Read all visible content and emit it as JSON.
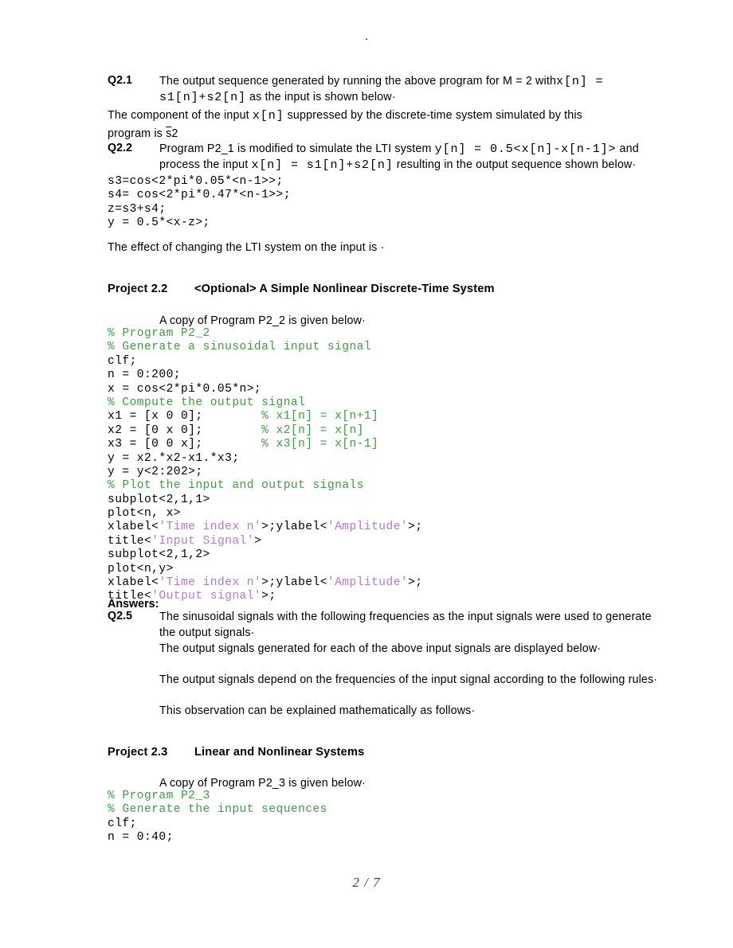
{
  "page": {
    "top_mark": ".",
    "footer": "2 / 7"
  },
  "q21": {
    "label": "Q2.1",
    "text_a": "The  output  sequence  generated  by  running  the  above  program  for  M  =  2  with",
    "math_a": "x[n] =",
    "math_b": "s1[n]+s2[n]",
    "text_b": " as the input is shown below·"
  },
  "component": {
    "text_a": "The component of the input ",
    "math_a": "x[n]",
    "text_b": " suppressed by the discrete-time system simulated by this",
    "line2_a": "program is ",
    "line2_strike": "s",
    "line2_b": "2"
  },
  "q22": {
    "label": "Q2.2",
    "text_a": "Program P2_1 is modified to simulate the LTI system ",
    "math_a": "y[n] = 0.5<x[n]-x[n-1]>",
    "text_b": " and",
    "line2_a": "process the input ",
    "math_b": "x[n] = s1[n]+s2[n]",
    "line2_b": " resulting in the output sequence shown below·"
  },
  "code_a": {
    "lines": [
      [
        {
          "t": "s3=cos<2*pi*0.05*<n-1>>;",
          "c": "plain"
        }
      ],
      [
        {
          "t": "s4= cos<2*pi*0.47*<n-1>>;",
          "c": "plain"
        }
      ],
      [
        {
          "t": "z=s3+s4;",
          "c": "plain"
        }
      ],
      [
        {
          "t": "y = 0.5*<x-z>;",
          "c": "plain"
        }
      ]
    ]
  },
  "effect": {
    "text": "The effect of changing the LTI system on the input is ",
    "mark": "·"
  },
  "project22": {
    "label": "Project 2.2",
    "title": "<Optional> A Simple Nonlinear Discrete-Time System",
    "copy_line": "A copy of Program P2_2 is given below·"
  },
  "code_main": {
    "lines": [
      [
        {
          "t": "% Program P2_2",
          "c": "comment"
        }
      ],
      [
        {
          "t": "% Generate a sinusoidal input signal",
          "c": "comment"
        }
      ],
      [
        {
          "t": "clf;",
          "c": "plain"
        }
      ],
      [
        {
          "t": "n = 0:200;",
          "c": "plain"
        }
      ],
      [
        {
          "t": "x = cos<2*pi*0.05*n>;",
          "c": "plain"
        }
      ],
      [
        {
          "t": "% Compute the output signal",
          "c": "comment"
        }
      ],
      [
        {
          "t": "x1 = [x 0 0];        ",
          "c": "plain"
        },
        {
          "t": "% x1[n] = x[n+1]",
          "c": "comment"
        }
      ],
      [
        {
          "t": "x2 = [0 x 0];        ",
          "c": "plain"
        },
        {
          "t": "% x2[n] = x[n]",
          "c": "comment"
        }
      ],
      [
        {
          "t": "x3 = [0 0 x];        ",
          "c": "plain"
        },
        {
          "t": "% x3[n] = x[n-1]",
          "c": "comment"
        }
      ],
      [
        {
          "t": "y = x2.*x2-x1.*x3;",
          "c": "plain"
        }
      ],
      [
        {
          "t": "y = y<2:202>;",
          "c": "plain"
        }
      ],
      [
        {
          "t": "% Plot the input and output signals",
          "c": "comment"
        }
      ],
      [
        {
          "t": "subplot<2,1,1>",
          "c": "plain"
        }
      ],
      [
        {
          "t": "plot<n, x>",
          "c": "plain"
        }
      ],
      [
        {
          "t": "xlabel<",
          "c": "plain"
        },
        {
          "t": "'Time index n'",
          "c": "string"
        },
        {
          "t": ">;ylabel<",
          "c": "plain"
        },
        {
          "t": "'Amplitude'",
          "c": "string"
        },
        {
          "t": ">;",
          "c": "plain"
        }
      ],
      [
        {
          "t": "title<",
          "c": "plain"
        },
        {
          "t": "'Input Signal'",
          "c": "string"
        },
        {
          "t": ">",
          "c": "plain"
        }
      ],
      [
        {
          "t": "subplot<2,1,2>",
          "c": "plain"
        }
      ],
      [
        {
          "t": "plot<n,y>",
          "c": "plain"
        }
      ],
      [
        {
          "t": "xlabel<",
          "c": "plain"
        },
        {
          "t": "'Time index n'",
          "c": "string"
        },
        {
          "t": ">;ylabel<",
          "c": "plain"
        },
        {
          "t": "'Amplitude'",
          "c": "string"
        },
        {
          "t": ">;",
          "c": "plain"
        }
      ],
      [
        {
          "t": "title<",
          "c": "plain"
        },
        {
          "t": "'Output signal'",
          "c": "string"
        },
        {
          "t": ">;",
          "c": "plain"
        }
      ]
    ]
  },
  "answers": {
    "label": "Answers:",
    "q25_label": "Q2.5",
    "line1": "The sinusoidal signals with the following frequencies as the input signals were used to generate",
    "line2": "the output signals·",
    "line3": "The output signals generated for each of the above input signals are displayed below·",
    "line4": "The output signals depend on the frequencies of the input signal according to the following rules·",
    "line5": "This observation can be explained mathematically as follows·"
  },
  "project23": {
    "label": "Project 2.3",
    "title": "Linear and Nonlinear Systems",
    "copy_line": "A copy of Program P2_3 is given below·"
  },
  "code_b": {
    "lines": [
      [
        {
          "t": "% Program P2_3",
          "c": "comment"
        }
      ],
      [
        {
          "t": "% Generate the input sequences",
          "c": "comment"
        }
      ],
      [
        {
          "t": "clf;",
          "c": "plain"
        }
      ],
      [
        {
          "t": "n = 0:40;",
          "c": "plain"
        }
      ]
    ]
  },
  "colors": {
    "comment_green": "#3f9b46",
    "string_purple": "#b07ad6",
    "text_black": "#000000",
    "page_bg": "#ffffff"
  }
}
